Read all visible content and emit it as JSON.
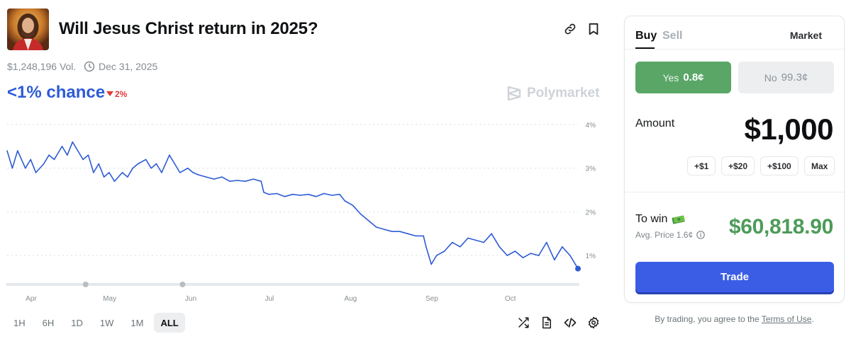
{
  "market": {
    "title": "Will Jesus Christ return in 2025?",
    "volume": "$1,248,196 Vol.",
    "end_date": "Dec 31, 2025",
    "chance": "<1% chance",
    "change": "2%",
    "change_direction": "down",
    "brand": "Polymarket",
    "thumbnail_icon": "jesus-portrait"
  },
  "header_icons": [
    "link-icon",
    "bookmark-icon"
  ],
  "timeframes": [
    {
      "label": "1H",
      "active": false
    },
    {
      "label": "6H",
      "active": false
    },
    {
      "label": "1D",
      "active": false
    },
    {
      "label": "1W",
      "active": false
    },
    {
      "label": "1M",
      "active": false
    },
    {
      "label": "ALL",
      "active": true
    }
  ],
  "chart_tools": [
    "shuffle-icon",
    "document-icon",
    "code-icon",
    "settings-icon"
  ],
  "colors": {
    "line": "#2d5bd6",
    "yes": "#5aa667",
    "trade": "#3b5de6",
    "win": "#4e9b5a",
    "down": "#e23939"
  },
  "chart_data": {
    "type": "line",
    "title": "",
    "xlabel": "",
    "ylabel": "",
    "x_ticks": [
      "Apr",
      "May",
      "Jun",
      "Jul",
      "Aug",
      "Sep",
      "Oct"
    ],
    "y_ticks": [
      "1%",
      "2%",
      "3%",
      "4%"
    ],
    "ylim": [
      0.5,
      4.0
    ],
    "xlim": [
      "2025-03-25",
      "2025-10-29"
    ],
    "grid": "horizontal dotted",
    "series": [
      {
        "name": "",
        "color": "#2d5bd6",
        "x": [
          "2025-03-25",
          "2025-03-27",
          "2025-03-29",
          "2025-04-01",
          "2025-04-03",
          "2025-04-05",
          "2025-04-08",
          "2025-04-10",
          "2025-04-12",
          "2025-04-15",
          "2025-04-17",
          "2025-04-19",
          "2025-04-21",
          "2025-04-23",
          "2025-04-25",
          "2025-04-27",
          "2025-04-29",
          "2025-05-01",
          "2025-05-03",
          "2025-05-05",
          "2025-05-08",
          "2025-05-10",
          "2025-05-12",
          "2025-05-14",
          "2025-05-17",
          "2025-05-19",
          "2025-05-21",
          "2025-05-23",
          "2025-05-26",
          "2025-05-28",
          "2025-05-30",
          "2025-06-02",
          "2025-06-04",
          "2025-06-06",
          "2025-06-09",
          "2025-06-12",
          "2025-06-15",
          "2025-06-18",
          "2025-06-21",
          "2025-06-24",
          "2025-06-27",
          "2025-06-30",
          "2025-07-01",
          "2025-07-03",
          "2025-07-06",
          "2025-07-09",
          "2025-07-12",
          "2025-07-15",
          "2025-07-18",
          "2025-07-21",
          "2025-07-24",
          "2025-07-27",
          "2025-07-30",
          "2025-08-01",
          "2025-08-04",
          "2025-08-07",
          "2025-08-10",
          "2025-08-13",
          "2025-08-16",
          "2025-08-19",
          "2025-08-22",
          "2025-08-25",
          "2025-08-28",
          "2025-08-31",
          "2025-09-01",
          "2025-09-03",
          "2025-09-05",
          "2025-09-08",
          "2025-09-11",
          "2025-09-14",
          "2025-09-17",
          "2025-09-20",
          "2025-09-23",
          "2025-09-26",
          "2025-09-29",
          "2025-10-02",
          "2025-10-05",
          "2025-10-08",
          "2025-10-11",
          "2025-10-14",
          "2025-10-17",
          "2025-10-20",
          "2025-10-23",
          "2025-10-26",
          "2025-10-28",
          "2025-10-29"
        ],
        "y": [
          3.4,
          3.0,
          3.4,
          3.0,
          3.2,
          2.9,
          3.1,
          3.3,
          3.2,
          3.5,
          3.3,
          3.6,
          3.4,
          3.2,
          3.3,
          2.9,
          3.1,
          2.8,
          2.9,
          2.7,
          2.9,
          2.8,
          3.0,
          3.1,
          3.2,
          3.0,
          3.1,
          2.9,
          3.3,
          3.1,
          2.9,
          3.0,
          2.9,
          2.85,
          2.8,
          2.75,
          2.8,
          2.7,
          2.72,
          2.7,
          2.75,
          2.7,
          2.45,
          2.4,
          2.42,
          2.35,
          2.4,
          2.38,
          2.4,
          2.35,
          2.42,
          2.38,
          2.4,
          2.25,
          2.15,
          1.95,
          1.8,
          1.65,
          1.6,
          1.55,
          1.55,
          1.5,
          1.45,
          1.45,
          1.2,
          0.8,
          1.0,
          1.1,
          1.3,
          1.2,
          1.4,
          1.35,
          1.3,
          1.5,
          1.2,
          1.0,
          1.1,
          0.95,
          1.05,
          1.0,
          1.3,
          0.9,
          1.2,
          1.0,
          0.8,
          0.7
        ]
      }
    ]
  },
  "trade": {
    "tab_buy": "Buy",
    "tab_sell": "Sell",
    "order_type": "Market",
    "yes_label": "Yes",
    "yes_price": "0.8¢",
    "no_label": "No",
    "no_price": "99.3¢",
    "amount_label": "Amount",
    "amount_value": "$1,000",
    "quick_amounts": [
      "+$1",
      "+$20",
      "+$100",
      "Max"
    ],
    "to_win_label": "To win",
    "avg_price": "Avg. Price 1.6¢",
    "to_win_value": "$60,818.90",
    "trade_button": "Trade",
    "terms_prefix": "By trading, you agree to the",
    "terms_link": "Terms of Use",
    "terms_suffix": "."
  }
}
